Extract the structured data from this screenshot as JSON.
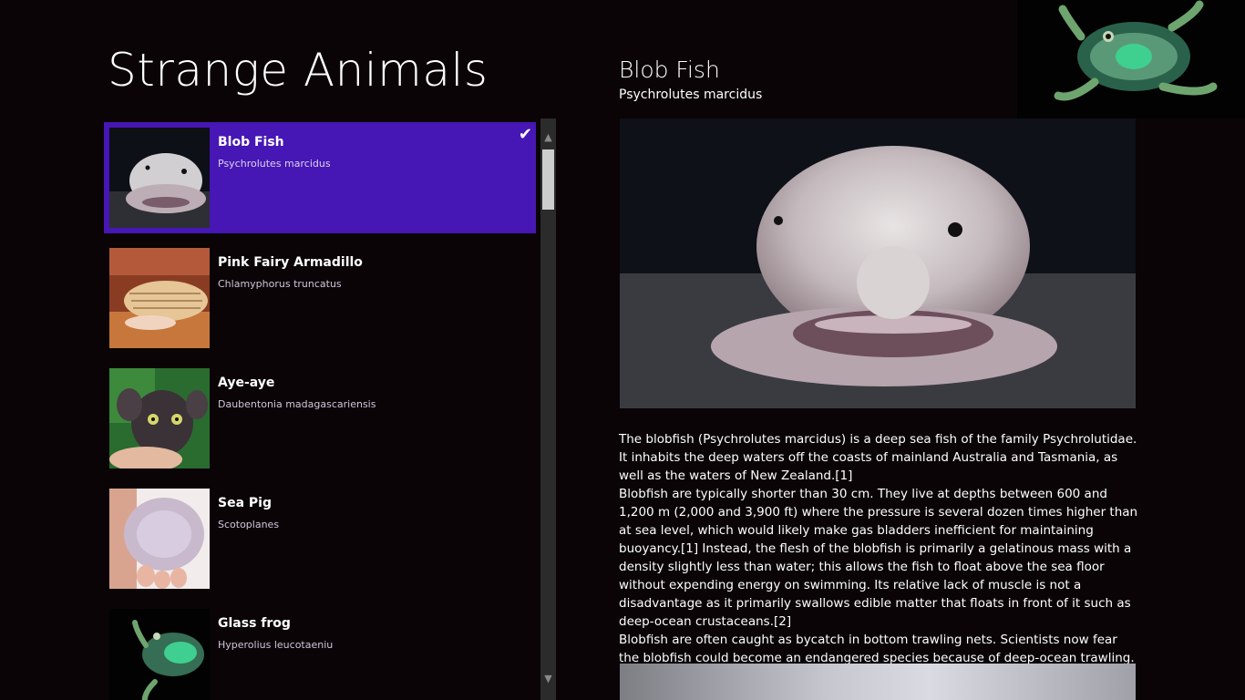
{
  "app": {
    "title": "Strange Animals"
  },
  "list": {
    "items": [
      {
        "title": "Blob Fish",
        "subtitle": "Psychrolutes marcidus",
        "selected": true,
        "icon": "blobfish-thumbnail"
      },
      {
        "title": "Pink Fairy Armadillo",
        "subtitle": "Chlamyphorus truncatus",
        "selected": false,
        "icon": "armadillo-thumbnail"
      },
      {
        "title": "Aye-aye",
        "subtitle": "Daubentonia madagascariensis",
        "selected": false,
        "icon": "aye-aye-thumbnail"
      },
      {
        "title": "Sea Pig",
        "subtitle": "Scotoplanes",
        "selected": false,
        "icon": "sea-pig-thumbnail"
      },
      {
        "title": "Glass frog",
        "subtitle": "Hyperolius leucotaeniu",
        "selected": false,
        "icon": "glass-frog-thumbnail"
      }
    ],
    "selected_check": "✔"
  },
  "scrollbar": {
    "up": "▲",
    "down": "▼"
  },
  "detail": {
    "title": "Blob Fish",
    "subtitle": "Psychrolutes marcidus",
    "paragraphs": [
      "The blobfish (Psychrolutes marcidus) is a deep sea fish of the family Psychrolutidae. It inhabits the deep waters off the coasts of mainland Australia and Tasmania, as well as the waters of New Zealand.[1]",
      "Blobfish are typically shorter than 30 cm. They live at depths between 600 and 1,200 m (2,000 and 3,900 ft) where the pressure is several dozen times higher than at sea level, which would likely make gas bladders inefficient for maintaining buoyancy.[1] Instead, the flesh of the blobfish is primarily a gelatinous mass with a density slightly less than water; this allows the fish to float above the sea floor without expending energy on swimming. Its relative lack of muscle is not a disadvantage as it primarily swallows edible matter that floats in front of it such as deep-ocean crustaceans.[2]",
      "Blobfish are often caught as bycatch in bottom trawling nets. Scientists now fear the blobfish could become an endangered species because of deep-ocean trawling."
    ]
  },
  "colors": {
    "background": "#0a0407",
    "selected": "#4617b4",
    "scrollbar": "#2b2b2b"
  }
}
